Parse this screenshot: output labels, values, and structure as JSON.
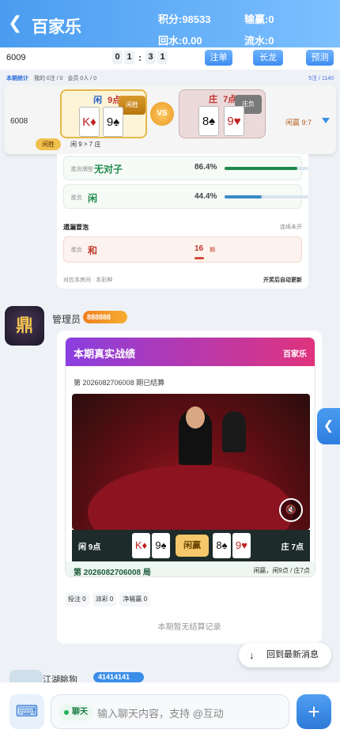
{
  "header": {
    "title": "百家乐",
    "points": "积分:98533",
    "win_loss": "输赢:0",
    "rebate": "回水:0.00",
    "turnover": "流水:0"
  },
  "timer": {
    "period": "6009",
    "digits": [
      "0",
      "1",
      "3",
      "1"
    ],
    "colon": ":",
    "buttons": [
      "注单",
      "长龙",
      "预测"
    ]
  },
  "stats_line": {
    "label": "本期统计",
    "mine": "我的 0注 / 0",
    "members": "会员 0人 / 0",
    "right": "5注 / 1140"
  },
  "result": {
    "id": "6008",
    "player_label": "闲",
    "player_points": "9点",
    "player_tag": "闲胜",
    "banker_label": "庄",
    "banker_points": "7点",
    "banker_tag": "庄负",
    "vs": "VS",
    "win_text": "闲赢 9:7",
    "result_tag": "闲胜",
    "desc": "闲 9 > 7 庄",
    "player_cards": [
      "K♦",
      "9♠"
    ],
    "banker_cards": [
      "8♠",
      "9♥"
    ]
  },
  "trend": {
    "rows": [
      {
        "label": "胜负牌型",
        "value": "无对子",
        "pct": "86.4%",
        "fill": 0.864,
        "color": "#1e8a4a"
      },
      {
        "label": "胜负",
        "value": "闲",
        "pct": "44.4%",
        "fill": 0.444,
        "color": "#3a8bc9"
      }
    ],
    "missing_title": "遗漏冒泡",
    "missing_right": "连续未开",
    "miss_label": "胜负",
    "miss_value": "和",
    "miss_count": "16",
    "miss_unit": "期",
    "footer_left": "对应本房间 · 本彩种",
    "footer_right": "开奖后自动更新"
  },
  "admin": {
    "avatar_text": "鼎",
    "name": "管理员",
    "level": "888888"
  },
  "battle": {
    "title": "本期真实战绩",
    "game": "百家乐",
    "sub": "第 2026082706008 期已结算",
    "player_points": "闲 9点",
    "banker_points": "庄 7点",
    "win_btn": "闲赢",
    "round": "第 2026082706008 局",
    "round_result": "闲赢，闲9点 / 庄7点",
    "player_cards": [
      "K♦",
      "9♠"
    ],
    "banker_cards": [
      "8♠",
      "9♥"
    ],
    "mute_icon": "speaker-mute-icon"
  },
  "chips": [
    "投注 0",
    "派彩 0",
    "净输赢 0"
  ],
  "no_settle": "本期暂无结算记录",
  "back_to_latest": "回到最新消息",
  "next_msg": {
    "name": "江湖眺狗",
    "level": "41414141"
  },
  "input": {
    "mode": "聊天",
    "placeholder": "输入聊天内容，支持 @互动"
  }
}
